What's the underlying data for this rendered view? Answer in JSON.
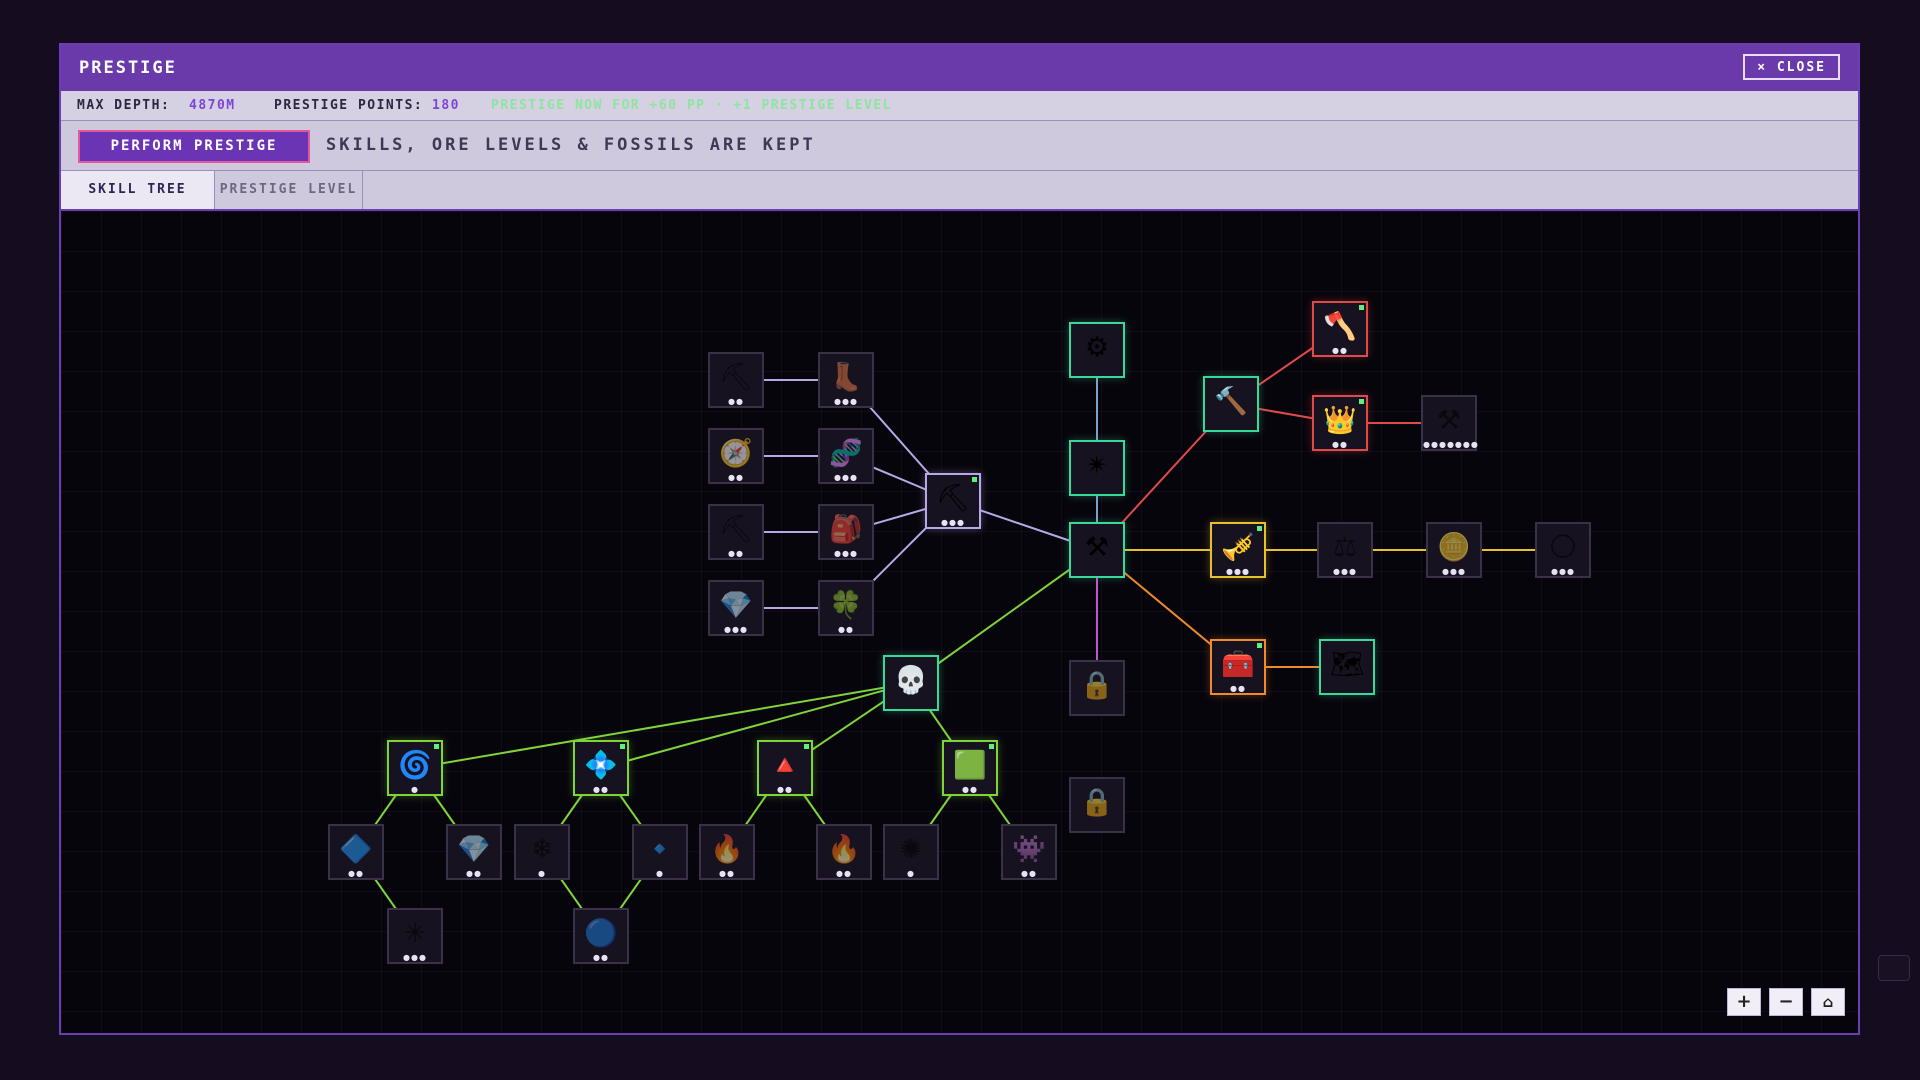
{
  "window": {
    "title": "PRESTIGE",
    "close_label": "× CLOSE"
  },
  "stats": {
    "max_depth_label": "MAX DEPTH:",
    "max_depth_value": "4870M",
    "points_label": "PRESTIGE POINTS:",
    "points_value": "180",
    "hint": "PRESTIGE NOW FOR +60 PP · +1 PRESTIGE LEVEL"
  },
  "action": {
    "perform_label": "PERFORM PRESTIGE",
    "kept_text": "SKILLS, ORE LEVELS & FOSSILS ARE KEPT"
  },
  "tabs": [
    {
      "label": "SKILL TREE",
      "active": true
    },
    {
      "label": "PRESTIGE LEVEL",
      "active": false
    }
  ],
  "zoom": {
    "plus": "+",
    "minus": "−",
    "home": "⌂"
  },
  "colors": {
    "accent": "#6a3aaa",
    "purple_link": "#b9a8e8",
    "green_link": "#7fd43a",
    "red_link": "#e04a4a",
    "yellow_link": "#e8c02a",
    "orange_link": "#f08a2a",
    "blue_link": "#7fa0c8",
    "pink_link": "#c056c9",
    "active_border": "#39d99a"
  },
  "nodes": [
    {
      "id": "root",
      "icon": "crossed-pickaxes-icon",
      "glyph": "⚒",
      "border": "#39d99a",
      "active": true,
      "dots": ""
    },
    {
      "id": "top-drill",
      "icon": "drill-bomb-icon",
      "glyph": "⚙",
      "border": "#39d99a",
      "active": true,
      "dots": ""
    },
    {
      "id": "top-star",
      "icon": "star-sigil-icon",
      "glyph": "✴",
      "border": "#39d99a",
      "active": true,
      "dots": ""
    },
    {
      "id": "lock-1",
      "icon": "lock-icon",
      "glyph": "🔒",
      "border": "#3a3048",
      "active": false,
      "dots": ""
    },
    {
      "id": "lock-2",
      "icon": "lock-icon",
      "glyph": "🔒",
      "border": "#3a3048",
      "active": false,
      "dots": ""
    },
    {
      "id": "purple-hub",
      "icon": "enchanted-pickaxe-icon",
      "glyph": "⛏",
      "border": "#b9a8e8",
      "active": true,
      "dots": "●●●",
      "pip": true
    },
    {
      "id": "p-pickaxe",
      "icon": "golden-pickaxe-icon",
      "glyph": "⛏",
      "border": "#3a3048",
      "active": false,
      "dots": "●●"
    },
    {
      "id": "p-boots",
      "icon": "boots-icon",
      "glyph": "👢",
      "border": "#3a3048",
      "active": false,
      "dots": "●●●"
    },
    {
      "id": "p-compass",
      "icon": "compass-icon",
      "glyph": "🧭",
      "border": "#3a3048",
      "active": false,
      "dots": "●●"
    },
    {
      "id": "p-dna",
      "icon": "dna-icon",
      "glyph": "🧬",
      "border": "#3a3048",
      "active": false,
      "dots": "●●●"
    },
    {
      "id": "p-drill",
      "icon": "hand-drill-icon",
      "glyph": "⛏",
      "border": "#3a3048",
      "active": false,
      "dots": "●●"
    },
    {
      "id": "p-backpack",
      "icon": "ore-backpack-icon",
      "glyph": "🎒",
      "border": "#3a3048",
      "active": false,
      "dots": "●●●"
    },
    {
      "id": "p-gems",
      "icon": "gem-pile-icon",
      "glyph": "💎",
      "border": "#3a3048",
      "active": false,
      "dots": "●●●"
    },
    {
      "id": "p-clover",
      "icon": "four-leaf-clover-icon",
      "glyph": "🍀",
      "border": "#3a3048",
      "active": false,
      "dots": "●●"
    },
    {
      "id": "r-hammer",
      "icon": "war-hammer-icon",
      "glyph": "🔨",
      "border": "#39d99a",
      "active": true,
      "dots": ""
    },
    {
      "id": "r-axe",
      "icon": "fire-axe-icon",
      "glyph": "🪓",
      "border": "#e04a4a",
      "active": true,
      "dots": "●●",
      "pip": true
    },
    {
      "id": "r-crown",
      "icon": "crown-icon",
      "glyph": "👑",
      "border": "#e04a4a",
      "active": true,
      "dots": "●●",
      "pip": true
    },
    {
      "id": "r-anvil",
      "icon": "anvil-icon",
      "glyph": "⚒",
      "border": "#3a3048",
      "active": false,
      "dots": "●●●●●●●"
    },
    {
      "id": "y-horn",
      "icon": "golden-horn-icon",
      "glyph": "🎺",
      "border": "#e8c02a",
      "active": true,
      "dots": "●●●",
      "pip": true
    },
    {
      "id": "y-scales",
      "icon": "scales-icon",
      "glyph": "⚖",
      "border": "#3a3048",
      "active": false,
      "dots": "●●●"
    },
    {
      "id": "y-coin1",
      "icon": "gold-coin-icon",
      "glyph": "🪙",
      "border": "#3a3048",
      "active": false,
      "dots": "●●●"
    },
    {
      "id": "y-coin2",
      "icon": "moon-coin-icon",
      "glyph": "🌕",
      "border": "#3a3048",
      "active": false,
      "dots": "●●●"
    },
    {
      "id": "o-chest",
      "icon": "treasure-chest-icon",
      "glyph": "🧰",
      "border": "#f08a2a",
      "active": true,
      "dots": "●●",
      "pip": true
    },
    {
      "id": "o-map",
      "icon": "treasure-map-icon",
      "glyph": "🗺",
      "border": "#39d99a",
      "active": true,
      "dots": ""
    },
    {
      "id": "g-skull",
      "icon": "skull-emblem-icon",
      "glyph": "💀",
      "border": "#39d99a",
      "active": true,
      "dots": ""
    },
    {
      "id": "g-swirl",
      "icon": "vortex-icon",
      "glyph": "🌀",
      "border": "#7fd43a",
      "active": true,
      "dots": "●",
      "pip": true
    },
    {
      "id": "g-crystal",
      "icon": "crystal-cluster-icon",
      "glyph": "💠",
      "border": "#7fd43a",
      "active": true,
      "dots": "●●",
      "pip": true
    },
    {
      "id": "g-pyramid",
      "icon": "pyramid-icon",
      "glyph": "🔺",
      "border": "#7fd43a",
      "active": true,
      "dots": "●●",
      "pip": true
    },
    {
      "id": "g-ore",
      "icon": "green-ore-icon",
      "glyph": "🟩",
      "border": "#7fd43a",
      "active": true,
      "dots": "●●",
      "pip": true
    },
    {
      "id": "c-shard",
      "icon": "dark-shard-icon",
      "glyph": "🔷",
      "border": "#3a3048",
      "active": false,
      "dots": "●●"
    },
    {
      "id": "c-spiky",
      "icon": "ice-star-icon",
      "glyph": "✳",
      "border": "#3a3048",
      "active": false,
      "dots": "●●●"
    },
    {
      "id": "c-crystal2",
      "icon": "blue-crystal-icon",
      "glyph": "💎",
      "border": "#3a3048",
      "active": false,
      "dots": "●●"
    },
    {
      "id": "c-ice",
      "icon": "ice-shards-icon",
      "glyph": "❄",
      "border": "#3a3048",
      "active": false,
      "dots": "●"
    },
    {
      "id": "c-wand",
      "icon": "ice-wand-icon",
      "glyph": "🔹",
      "border": "#3a3048",
      "active": false,
      "dots": "●"
    },
    {
      "id": "c-orb",
      "icon": "frost-orb-icon",
      "glyph": "🔵",
      "border": "#3a3048",
      "active": false,
      "dots": "●●"
    },
    {
      "id": "c-furnace",
      "icon": "furnace-icon",
      "glyph": "🔥",
      "border": "#3a3048",
      "active": false,
      "dots": "●●"
    },
    {
      "id": "c-campfire",
      "icon": "campfire-icon",
      "glyph": "🔥",
      "border": "#3a3048",
      "active": false,
      "dots": "●●"
    },
    {
      "id": "c-spore",
      "icon": "spore-icon",
      "glyph": "✺",
      "border": "#3a3048",
      "active": false,
      "dots": "●"
    },
    {
      "id": "c-goblin",
      "icon": "goblin-chest-icon",
      "glyph": "👾",
      "border": "#3a3048",
      "active": false,
      "dots": "●●"
    }
  ]
}
